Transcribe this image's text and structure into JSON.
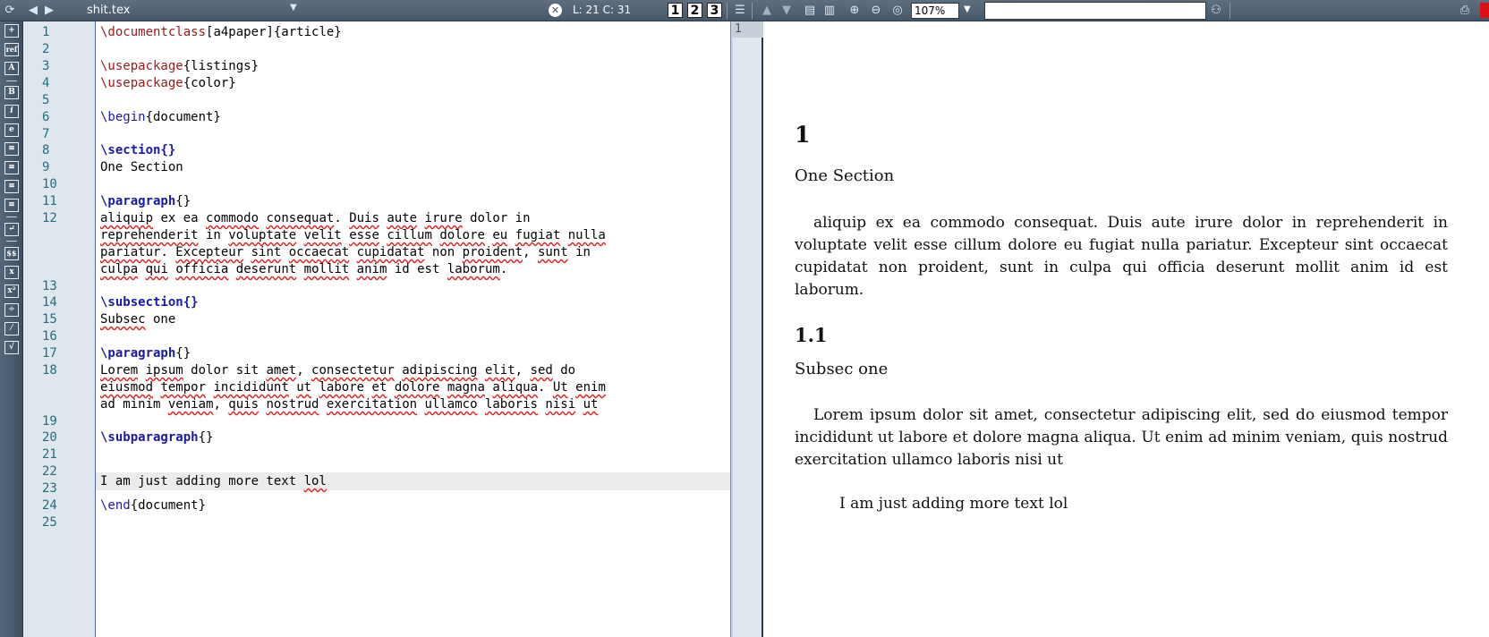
{
  "toolbar": {
    "filename": "shit.tex",
    "cursor_position": "L: 21 C: 31",
    "view_buttons": [
      "1",
      "2",
      "3"
    ],
    "zoom": "107%",
    "search_placeholder": ""
  },
  "left_toolbar": {
    "items": [
      "+",
      "ref",
      "A",
      "B",
      "i",
      "e",
      "≡",
      "≡",
      "≡",
      "≡",
      "↵",
      "$$",
      "x",
      "x²",
      "÷",
      "⁄",
      "√"
    ]
  },
  "editor": {
    "line_numbers": [
      "1",
      "2",
      "3",
      "4",
      "5",
      "6",
      "7",
      "8",
      "9",
      "10",
      "11",
      "12",
      "13",
      "14",
      "15",
      "16",
      "17",
      "18",
      "19",
      "20",
      "21",
      "22",
      "23",
      "24",
      "25"
    ],
    "current_line": 21
  },
  "pdf": {
    "page_number": "1",
    "section_number": "1",
    "section_title": "One Section",
    "paragraph1": "aliquip ex ea commodo consequat.  Duis aute irure dolor in reprehenderit in voluptate velit esse cillum dolore eu fugiat nulla pariatur.  Excepteur sint occaecat cupidatat non proident, sunt in culpa qui officia deserunt mollit anim id est laborum.",
    "subsection_number": "1.1",
    "subsection_title": "Subsec one",
    "paragraph2": "Lorem ipsum dolor sit amet, consectetur adipiscing elit, sed do eiusmod tempor incididunt ut labore et dolore magna aliqua.  Ut enim ad minim veniam, quis nostrud exercitation ullamco laboris nisi ut",
    "subparagraph": "I am just adding more text lol"
  },
  "colors": {
    "toolbar_bg": "#4f6174",
    "gutter_bg": "#dfe6ee",
    "line_number": "#1f6f7f",
    "command": "#9a1a1a",
    "section_cmd": "#1a1aaa",
    "spell_underline": "#e02020",
    "current_line_bg": "#ececec"
  }
}
